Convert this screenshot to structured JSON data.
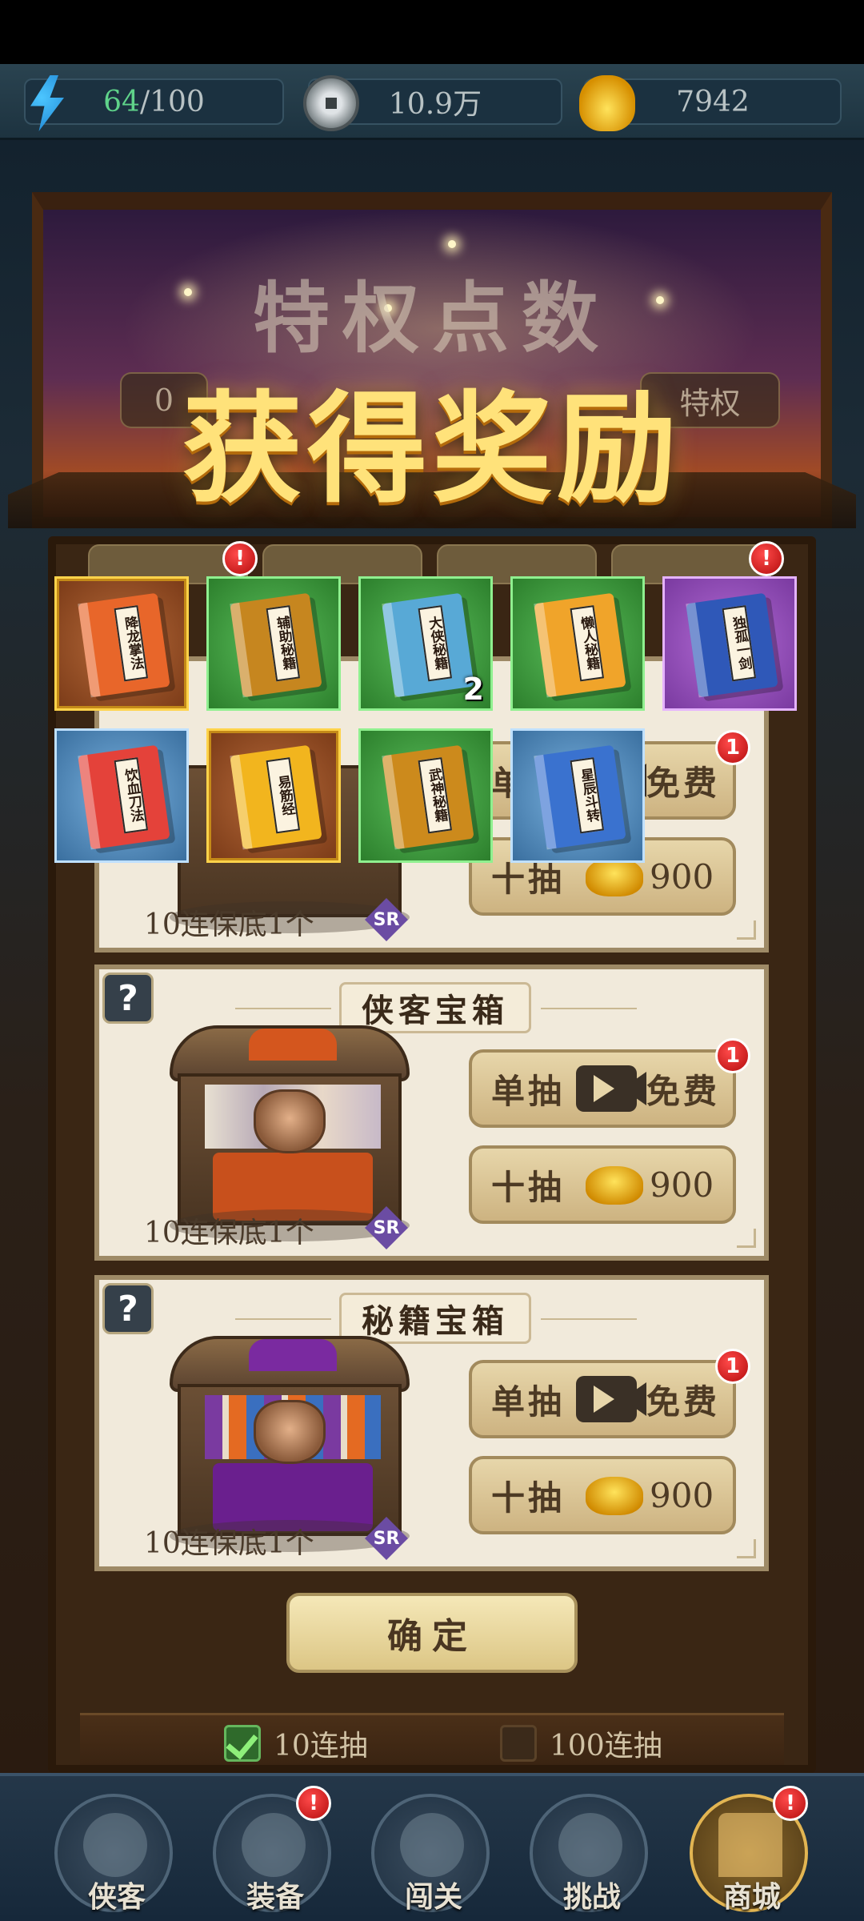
{
  "resources": {
    "energy": {
      "current": "64",
      "sep": "/",
      "max": "100",
      "icon": "lightning-icon"
    },
    "coins": {
      "value": "10.9万",
      "icon": "copper-coin-icon"
    },
    "gold": {
      "value": "7942",
      "icon": "gold-ingot-icon"
    }
  },
  "banner": {
    "subtitle": "特权点数",
    "title": "获得奖励",
    "chip_left": "0",
    "chip_right": "特权"
  },
  "reward_items": [
    {
      "name": "降龙掌法",
      "rarity": "orange",
      "book_color": "#e8662a",
      "count": ""
    },
    {
      "name": "辅助秘籍",
      "rarity": "green",
      "book_color": "#c6861f",
      "count": ""
    },
    {
      "name": "大侠秘籍",
      "rarity": "green",
      "book_color": "#58a9d6",
      "count": "2"
    },
    {
      "name": "懒人秘籍",
      "rarity": "green",
      "book_color": "#f0a42a",
      "count": ""
    },
    {
      "name": "独孤一剑",
      "rarity": "purple",
      "book_color": "#2f58b8",
      "count": ""
    },
    {
      "name": "饮血刀法",
      "rarity": "blue",
      "book_color": "#e4423a",
      "count": ""
    },
    {
      "name": "易筋经",
      "rarity": "orange",
      "book_color": "#f2b51e",
      "count": ""
    },
    {
      "name": "武神秘籍",
      "rarity": "green",
      "book_color": "#cc8a1c",
      "count": ""
    },
    {
      "name": "星辰斗转",
      "rarity": "blue",
      "book_color": "#3a72cf",
      "count": ""
    }
  ],
  "chests": [
    {
      "title": "",
      "guarantee": "10连保底1个",
      "rarity": "SR",
      "single": "单抽",
      "free": "免费",
      "ten": "十抽",
      "price": "900",
      "badge": "1",
      "colors": {
        "band": "#d4712a",
        "front": "#6a3a1c"
      }
    },
    {
      "title": "侠客宝箱",
      "guarantee": "10连保底1个",
      "rarity": "SR",
      "single": "单抽",
      "free": "免费",
      "ten": "十抽",
      "price": "900",
      "badge": "1",
      "colors": {
        "band": "#d4561e",
        "front": "#c8501c"
      }
    },
    {
      "title": "秘籍宝箱",
      "guarantee": "10连保底1个",
      "rarity": "SR",
      "single": "单抽",
      "free": "免费",
      "ten": "十抽",
      "price": "900",
      "badge": "1",
      "colors": {
        "band": "#7a2aa0",
        "front": "#6a1f8e"
      }
    }
  ],
  "help_icon": "?",
  "confirm_label": "确定",
  "draw_options": [
    {
      "label": "10连抽",
      "checked": true
    },
    {
      "label": "100连抽",
      "checked": false
    }
  ],
  "tab_badges": [
    "!",
    "!"
  ],
  "nav": [
    {
      "label": "侠客",
      "icon": "hero-icon",
      "badge": ""
    },
    {
      "label": "装备",
      "icon": "armor-icon",
      "badge": "!"
    },
    {
      "label": "闯关",
      "icon": "sword-icon",
      "badge": ""
    },
    {
      "label": "挑战",
      "icon": "demon-mask-icon",
      "badge": ""
    },
    {
      "label": "商城",
      "icon": "shop-gate-icon",
      "badge": "!",
      "active": true
    }
  ]
}
